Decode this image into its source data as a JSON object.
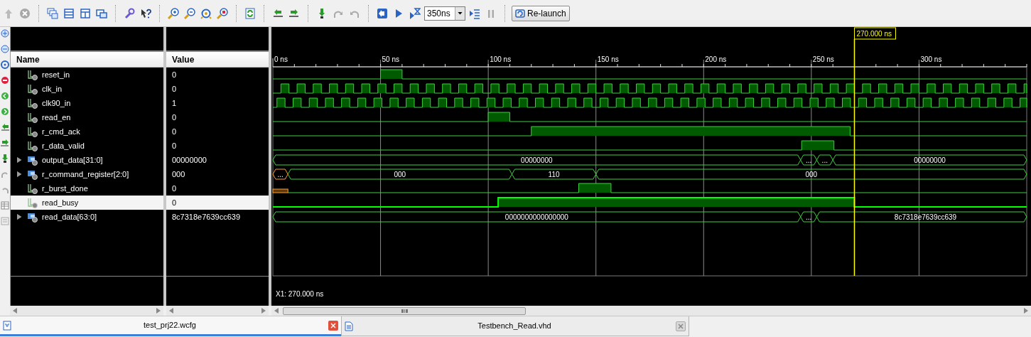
{
  "toolbar": {
    "time_field": {
      "value": "350ns"
    },
    "relaunch_button": "Re-launch"
  },
  "name_panel": {
    "header": "Name"
  },
  "value_panel": {
    "header": "Value"
  },
  "signals": [
    {
      "name": "reset_in",
      "kind": "bit",
      "value": "0",
      "selected": false
    },
    {
      "name": "clk_in",
      "kind": "bit",
      "value": "0",
      "selected": false
    },
    {
      "name": "clk90_in",
      "kind": "bit",
      "value": "1",
      "selected": false
    },
    {
      "name": "read_en",
      "kind": "bit",
      "value": "0",
      "selected": false
    },
    {
      "name": "r_cmd_ack",
      "kind": "bit",
      "value": "0",
      "selected": false
    },
    {
      "name": "r_data_valid",
      "kind": "bit",
      "value": "0",
      "selected": false
    },
    {
      "name": "output_data[31:0]",
      "kind": "bus",
      "value": "00000000",
      "selected": false,
      "segments": [
        {
          "label": "00000000",
          "kind": "value"
        },
        {
          "label": "...",
          "kind": "value"
        },
        {
          "label": "...",
          "kind": "value"
        },
        {
          "label": "00000000",
          "kind": "value"
        }
      ]
    },
    {
      "name": "r_command_register[2:0]",
      "kind": "bus",
      "value": "000",
      "selected": false,
      "segments": [
        {
          "label": "...",
          "kind": "unknown"
        },
        {
          "label": "000",
          "kind": "value"
        },
        {
          "label": "110",
          "kind": "value"
        },
        {
          "label": "000",
          "kind": "value"
        }
      ]
    },
    {
      "name": "r_burst_done",
      "kind": "bit",
      "value": "0",
      "selected": false
    },
    {
      "name": "read_busy",
      "kind": "bit",
      "value": "0",
      "selected": true
    },
    {
      "name": "read_data[63:0]",
      "kind": "bus",
      "value": "8c7318e7639cc639",
      "selected": false,
      "segments": [
        {
          "label": "0000000000000000",
          "kind": "value"
        },
        {
          "label": "...",
          "kind": "value"
        },
        {
          "label": "8c7318e7639cc639",
          "kind": "value"
        }
      ]
    }
  ],
  "ruler": [
    "0 ns",
    "50 ns",
    "100 ns",
    "150 ns",
    "200 ns",
    "250 ns",
    "300 ns"
  ],
  "cursor": {
    "label": "270.000 ns",
    "readout": "X1: 270.000 ns"
  },
  "tabs": [
    {
      "label": "test_prj22.wcfg",
      "selected": true
    },
    {
      "label": "Testbench_Read.vhd",
      "selected": false
    }
  ]
}
